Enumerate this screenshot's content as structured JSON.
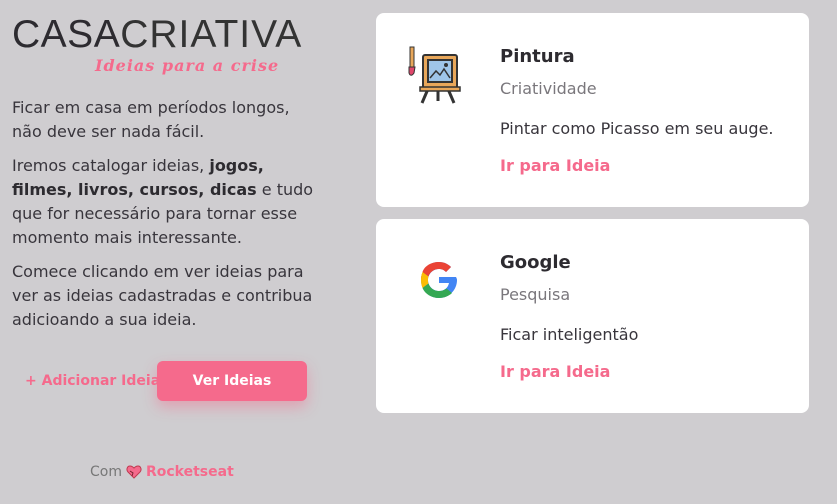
{
  "logo": {
    "bold": "CASA",
    "light": "CRIATIVA",
    "tagline": "Ideias para a crise"
  },
  "intro": {
    "p1": "Ficar em casa em períodos longos, não deve ser nada fácil.",
    "p2_start": "Iremos catalogar ideias, ",
    "p2_bold": "jogos, filmes, livros, cursos, dicas",
    "p2_end": " e tudo que for necessário para tornar esse momento mais interessante.",
    "p3": "Comece clicando em ver ideias para ver as ideias cadastradas e contribua adicioando a sua ideia."
  },
  "actions": {
    "add": "+ Adicionar Ideia",
    "see": "Ver Ideias"
  },
  "footer": {
    "with": "Com",
    "brand": "Rocketseat"
  },
  "ideas": [
    {
      "title": "Pintura",
      "category": "Criatividade",
      "description": "Pintar como Picasso em seu auge.",
      "link": "Ir para Ideia",
      "icon": "painting-easel-icon"
    },
    {
      "title": "Google",
      "category": "Pesquisa",
      "description": "Ficar inteligentão",
      "link": "Ir para Ideia",
      "icon": "google-icon"
    }
  ],
  "colors": {
    "accent": "#f56a8c",
    "background": "#cfcdd0",
    "card": "#ffffff"
  }
}
